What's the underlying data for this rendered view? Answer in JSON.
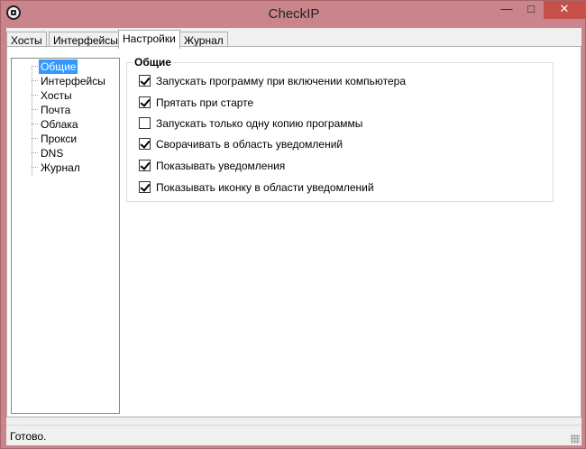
{
  "window": {
    "title": "CheckIP",
    "minimize_symbol": "—",
    "maximize_symbol": "□",
    "close_symbol": "✕",
    "close_color": "#c7504a"
  },
  "tabs": [
    {
      "label": "Хосты",
      "active": false
    },
    {
      "label": "Интерфейсы",
      "active": false
    },
    {
      "label": "Настройки",
      "active": true
    },
    {
      "label": "Журнал",
      "active": false
    }
  ],
  "tree": {
    "items": [
      {
        "label": "Общие",
        "selected": true
      },
      {
        "label": "Интерфейсы",
        "selected": false
      },
      {
        "label": "Хосты",
        "selected": false
      },
      {
        "label": "Почта",
        "selected": false
      },
      {
        "label": "Облака",
        "selected": false
      },
      {
        "label": "Прокси",
        "selected": false
      },
      {
        "label": "DNS",
        "selected": false
      },
      {
        "label": "Журнал",
        "selected": false
      }
    ]
  },
  "general": {
    "group_label": "Общие",
    "options": [
      {
        "label": "Запускать программу при включении компьютера",
        "checked": true
      },
      {
        "label": "Прятать при старте",
        "checked": true
      },
      {
        "label": "Запускать только одну копию программы",
        "checked": false
      },
      {
        "label": "Сворачивать в область уведомлений",
        "checked": true
      },
      {
        "label": "Показывать уведомления",
        "checked": true
      },
      {
        "label": "Показывать иконку в области уведомлений",
        "checked": true
      }
    ]
  },
  "status": {
    "text": "Готово."
  },
  "colors": {
    "selection": "#3399ff",
    "window_frame": "#c9858b"
  }
}
